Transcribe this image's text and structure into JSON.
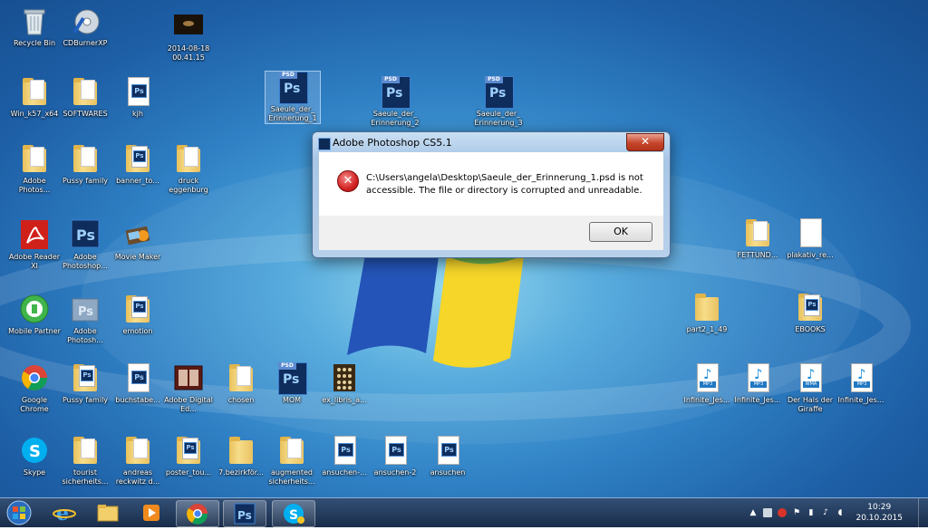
{
  "desktop": {
    "icons": [
      {
        "id": "recycle-bin",
        "label": "Recycle Bin",
        "type": "recycle"
      },
      {
        "id": "cdburnerxp",
        "label": "CDBurnerXP",
        "type": "cd"
      },
      {
        "id": "screenshot-file",
        "label": "2014-08-18 00.41.15",
        "type": "image"
      },
      {
        "id": "win-k57-x64",
        "label": "Win_k57_x64",
        "type": "folder"
      },
      {
        "id": "softwares",
        "label": "SOFTWARES",
        "type": "folder"
      },
      {
        "id": "kjh",
        "label": "kjh",
        "type": "psfile"
      },
      {
        "id": "saeule-1",
        "label": "Saeule_der_ Erinnerung_1",
        "type": "psd"
      },
      {
        "id": "saeule-2",
        "label": "Saeule_der_ Erinnerung_2",
        "type": "psd"
      },
      {
        "id": "saeule-3",
        "label": "Saeule_der_ Erinnerung_3",
        "type": "psd"
      },
      {
        "id": "adobe-photos-folder",
        "label": "Adobe Photos...",
        "type": "folder"
      },
      {
        "id": "pussy-family-1",
        "label": "Pussy family",
        "type": "folder"
      },
      {
        "id": "banner-to",
        "label": "banner_to...",
        "type": "psfile"
      },
      {
        "id": "druck-eggenburg",
        "label": "druck eggenburg",
        "type": "folder"
      },
      {
        "id": "adobe-reader",
        "label": "Adobe Reader XI",
        "type": "reader"
      },
      {
        "id": "adobe-photoshop",
        "label": "Adobe Photoshop...",
        "type": "psapp"
      },
      {
        "id": "movie-maker",
        "label": "Movie Maker",
        "type": "movie"
      },
      {
        "id": "fettund",
        "label": "FETTUND...",
        "type": "folder"
      },
      {
        "id": "plakativ-re",
        "label": "plakativ_re...",
        "type": "blank"
      },
      {
        "id": "mobile-partner",
        "label": "Mobile Partner",
        "type": "mobile"
      },
      {
        "id": "adobe-photosh-2",
        "label": "Adobe Photosh...",
        "type": "folder-ps"
      },
      {
        "id": "emotion",
        "label": "emotion",
        "type": "psfolder"
      },
      {
        "id": "part2-1-49",
        "label": "part2_1_49",
        "type": "folder"
      },
      {
        "id": "ebooks",
        "label": "EBOOKS",
        "type": "psfolder"
      },
      {
        "id": "google-chrome",
        "label": "Google Chrome",
        "type": "chrome"
      },
      {
        "id": "pussy-family-2",
        "label": "Pussy family",
        "type": "psfolder"
      },
      {
        "id": "buchstabe",
        "label": "buchstabe...",
        "type": "psfile"
      },
      {
        "id": "adobe-digital-ed",
        "label": "Adobe Digital Ed...",
        "type": "digital"
      },
      {
        "id": "chosen",
        "label": "chosen",
        "type": "folder"
      },
      {
        "id": "mom",
        "label": "MOM",
        "type": "psd"
      },
      {
        "id": "ex-libris",
        "label": "ex_libris_a...",
        "type": "pattern"
      },
      {
        "id": "infinite-1",
        "label": "Infinite_Jes...",
        "type": "mp3",
        "fmt": "MP3"
      },
      {
        "id": "infinite-2",
        "label": "Infinite_Jes...",
        "type": "mp3",
        "fmt": "MP3"
      },
      {
        "id": "hals-giraffe",
        "label": "Der Hals der Giraffe",
        "type": "mp3",
        "fmt": "WMA"
      },
      {
        "id": "infinite-3",
        "label": "Infinite_Jes...",
        "type": "mp3",
        "fmt": "MP3"
      },
      {
        "id": "skype",
        "label": "Skype",
        "type": "skype"
      },
      {
        "id": "tourist",
        "label": "tourist sicherheits...",
        "type": "folder"
      },
      {
        "id": "andreas",
        "label": "andreas reckwitz d...",
        "type": "folder"
      },
      {
        "id": "poster-tou",
        "label": "poster_tou...",
        "type": "psfolder"
      },
      {
        "id": "bezirk",
        "label": "7.bezirkför...",
        "type": "folder"
      },
      {
        "id": "augmented",
        "label": "augmented sicherheits...",
        "type": "folder"
      },
      {
        "id": "ansuchen-dash",
        "label": "ansuchen-...",
        "type": "psfile"
      },
      {
        "id": "ansuchen-2",
        "label": "ansuchen-2",
        "type": "psfile"
      },
      {
        "id": "ansuchen",
        "label": "ansuchen",
        "type": "psfile"
      }
    ]
  },
  "dialog": {
    "title": "Adobe Photoshop CS5.1",
    "close_label": "✕",
    "error_glyph": "✕",
    "message": "C:\\Users\\angela\\Desktop\\Saeule_der_Erinnerung_1.psd is not accessible. The file or directory is corrupted and unreadable.",
    "ok_label": "OK"
  },
  "taskbar": {
    "apps": [
      {
        "id": "start",
        "icon": "windows-start-icon"
      },
      {
        "id": "ie",
        "icon": "internet-explorer-icon"
      },
      {
        "id": "explorer",
        "icon": "folder-icon"
      },
      {
        "id": "media",
        "icon": "media-player-icon"
      },
      {
        "id": "chrome",
        "icon": "chrome-icon"
      },
      {
        "id": "photoshop",
        "icon": "photoshop-icon"
      },
      {
        "id": "skype",
        "icon": "skype-icon"
      }
    ],
    "time": "10:29",
    "date": "20.10.2015"
  },
  "colors": {
    "accent": "#2f80c4",
    "ps_blue": "#0f2d5c",
    "error_red": "#d32222"
  }
}
